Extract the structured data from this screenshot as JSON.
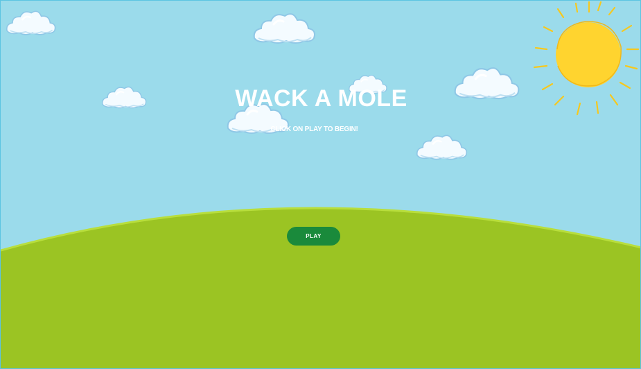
{
  "game": {
    "title": "WACK A MOLE",
    "subtitle": "CLICK ON PLAY TO BEGIN!",
    "play_label": "PLAY"
  },
  "colors": {
    "sky": "#9bdbeb",
    "hill": "#9bc423",
    "hill_edge": "#b8de3c",
    "sun": "#ffd42f",
    "sun_rays": "#f6c81e",
    "cloud": "#f4fbff",
    "cloud_shadow": "#8fc7e6",
    "button": "#1a8a3b"
  }
}
